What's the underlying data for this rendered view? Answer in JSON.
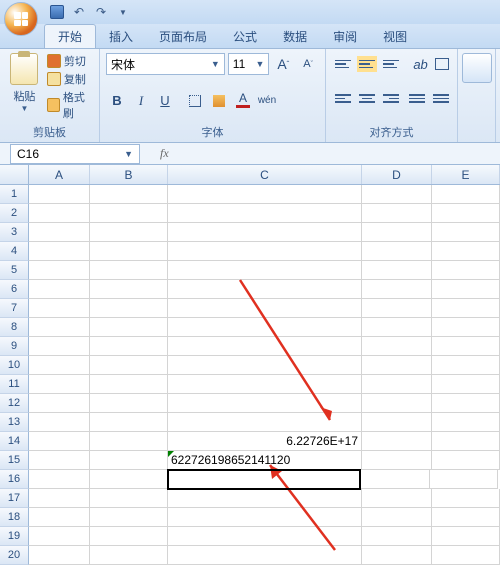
{
  "qat": {
    "save": "保存",
    "undo": "撤销",
    "redo": "重做"
  },
  "tabs": {
    "home": "开始",
    "insert": "插入",
    "layout": "页面布局",
    "formula": "公式",
    "data": "数据",
    "review": "审阅",
    "view": "视图"
  },
  "ribbon": {
    "clipboard": {
      "paste": "粘贴",
      "cut": "剪切",
      "copy": "复制",
      "format_painter": "格式刷",
      "label": "剪贴板"
    },
    "font": {
      "name": "宋体",
      "size": "11",
      "bold": "B",
      "italic": "I",
      "underline": "U",
      "label": "字体",
      "grow": "A",
      "shrink": "A",
      "pinyin": "wén"
    },
    "align": {
      "label": "对齐方式"
    }
  },
  "namebox": {
    "ref": "C16",
    "fx": "fx"
  },
  "columns": [
    "A",
    "B",
    "C",
    "D",
    "E"
  ],
  "rows": [
    "1",
    "2",
    "3",
    "4",
    "5",
    "6",
    "7",
    "8",
    "9",
    "10",
    "11",
    "12",
    "13",
    "14",
    "15",
    "16",
    "17",
    "18",
    "19",
    "20"
  ],
  "cells": {
    "C14": "6.22726E+17",
    "C15": "622726198652141120"
  },
  "chart_data": null
}
